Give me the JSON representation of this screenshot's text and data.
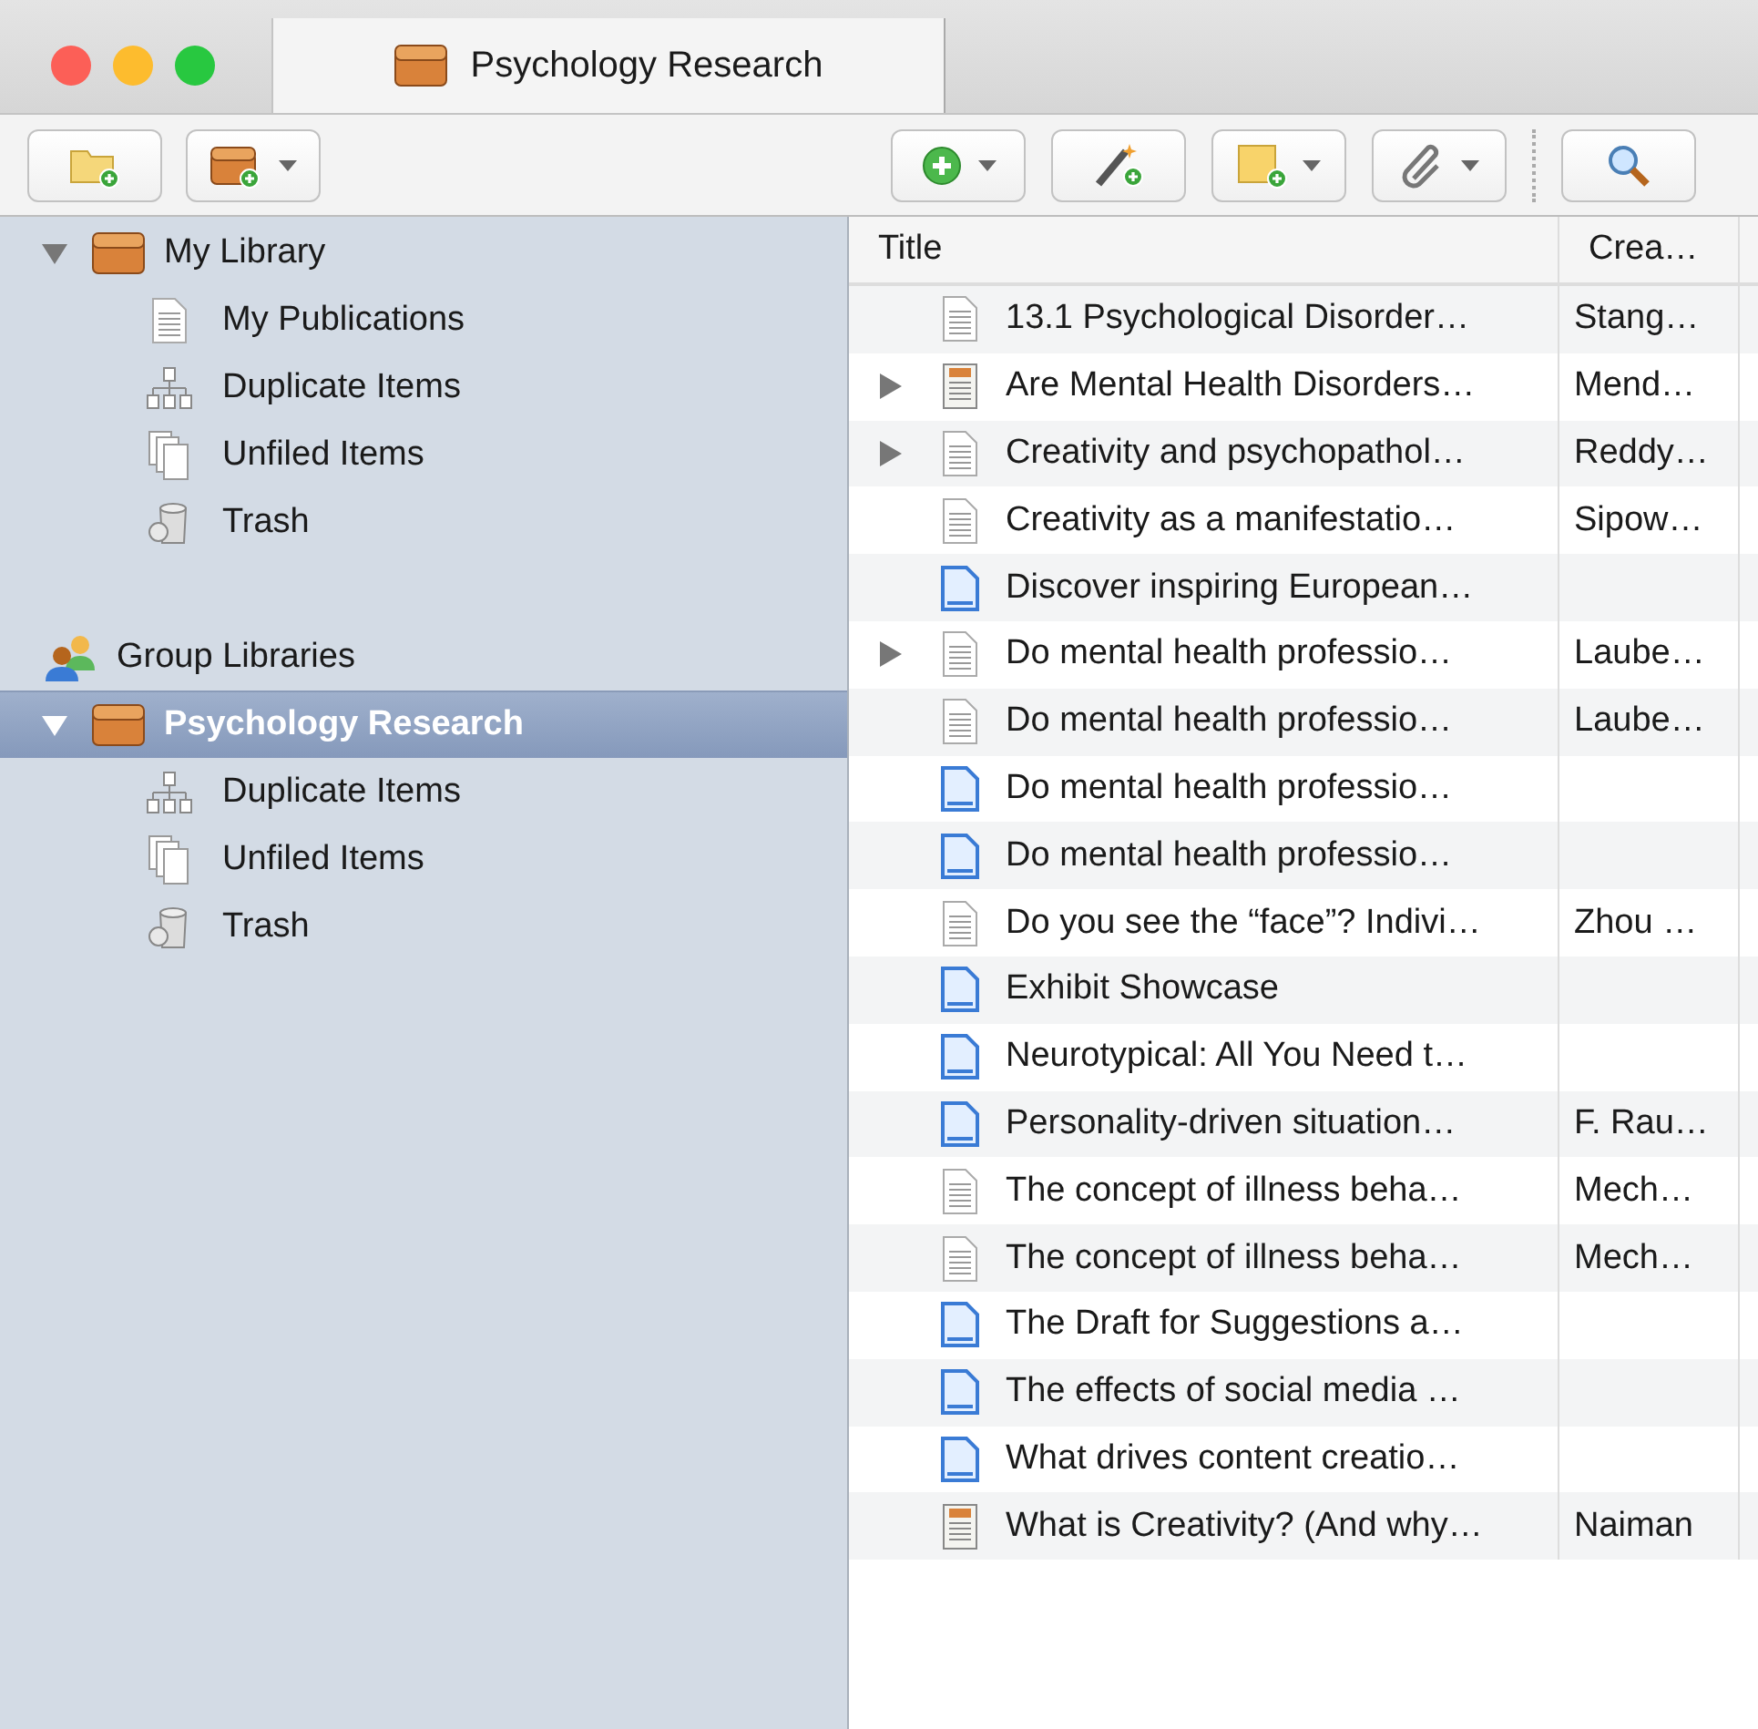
{
  "window": {
    "tabs": [
      {
        "label": "Psychology Research",
        "selected": true
      }
    ]
  },
  "toolbar": {
    "left": [
      {
        "kind": "new-collection",
        "dropdown": false
      },
      {
        "kind": "new-library",
        "dropdown": true
      }
    ],
    "right": [
      {
        "kind": "new-item",
        "dropdown": true
      },
      {
        "kind": "add-by-identifier",
        "dropdown": false
      },
      {
        "kind": "new-note",
        "dropdown": true
      },
      {
        "kind": "attach",
        "dropdown": true
      },
      {
        "kind": "search",
        "dropdown": false
      }
    ]
  },
  "sidebar": {
    "items": [
      {
        "kind": "library",
        "label": "My Library",
        "expanded": true,
        "selected": false,
        "children": [
          {
            "kind": "publications",
            "label": "My Publications",
            "selected": false
          },
          {
            "kind": "duplicates",
            "label": "Duplicate Items",
            "selected": false
          },
          {
            "kind": "unfiled",
            "label": "Unfiled Items",
            "selected": false
          },
          {
            "kind": "trash",
            "label": "Trash",
            "selected": false
          }
        ]
      },
      {
        "kind": "group-header",
        "label": "Group Libraries",
        "selected": false
      },
      {
        "kind": "library",
        "label": "Psychology Research",
        "expanded": true,
        "selected": true,
        "children": [
          {
            "kind": "duplicates",
            "label": "Duplicate Items",
            "selected": false
          },
          {
            "kind": "unfiled",
            "label": "Unfiled Items",
            "selected": false
          },
          {
            "kind": "trash",
            "label": "Trash",
            "selected": false
          }
        ]
      }
    ]
  },
  "table": {
    "columns": [
      "Title",
      "Crea…"
    ],
    "rows": [
      {
        "kind": "document",
        "title": "13.1 Psychological Disorder…",
        "creator": "Stang…",
        "has_children": false,
        "selected": false
      },
      {
        "kind": "newspaper",
        "title": "Are Mental Health Disorders…",
        "creator": "Mend…",
        "has_children": true,
        "selected": false
      },
      {
        "kind": "document",
        "title": "Creativity and psychopathol…",
        "creator": "Reddy…",
        "has_children": true,
        "selected": false
      },
      {
        "kind": "document",
        "title": "Creativity as a manifestatio…",
        "creator": "Sipow…",
        "has_children": false,
        "selected": false
      },
      {
        "kind": "webpage",
        "title": "Discover inspiring European…",
        "creator": "",
        "has_children": false,
        "selected": false
      },
      {
        "kind": "document",
        "title": "Do mental health professio…",
        "creator": "Laube…",
        "has_children": true,
        "selected": false
      },
      {
        "kind": "document",
        "title": "Do mental health professio…",
        "creator": "Laube…",
        "has_children": false,
        "selected": false
      },
      {
        "kind": "webpage",
        "title": "Do mental health professio…",
        "creator": "",
        "has_children": false,
        "selected": false
      },
      {
        "kind": "webpage",
        "title": "Do mental health professio…",
        "creator": "",
        "has_children": false,
        "selected": false
      },
      {
        "kind": "document",
        "title": "Do you see the “face”? Indivi…",
        "creator": "Zhou …",
        "has_children": false,
        "selected": false
      },
      {
        "kind": "webpage",
        "title": "Exhibit Showcase",
        "creator": "",
        "has_children": false,
        "selected": false
      },
      {
        "kind": "webpage",
        "title": "Neurotypical: All You Need t…",
        "creator": "",
        "has_children": false,
        "selected": false
      },
      {
        "kind": "webpage",
        "title": "Personality-driven situation…",
        "creator": "F. Rau…",
        "has_children": false,
        "selected": false
      },
      {
        "kind": "document",
        "title": "The concept of illness beha…",
        "creator": "Mech…",
        "has_children": false,
        "selected": false
      },
      {
        "kind": "document",
        "title": "The concept of illness beha…",
        "creator": "Mech…",
        "has_children": false,
        "selected": false
      },
      {
        "kind": "webpage",
        "title": "The Draft for Suggestions a…",
        "creator": "",
        "has_children": false,
        "selected": false
      },
      {
        "kind": "webpage",
        "title": "The effects of social media …",
        "creator": "",
        "has_children": false,
        "selected": false
      },
      {
        "kind": "webpage",
        "title": "What drives content creatio…",
        "creator": "",
        "has_children": false,
        "selected": false
      },
      {
        "kind": "newspaper",
        "title": "What is Creativity? (And why…",
        "creator": "Naiman",
        "has_children": false,
        "selected": false
      }
    ]
  }
}
